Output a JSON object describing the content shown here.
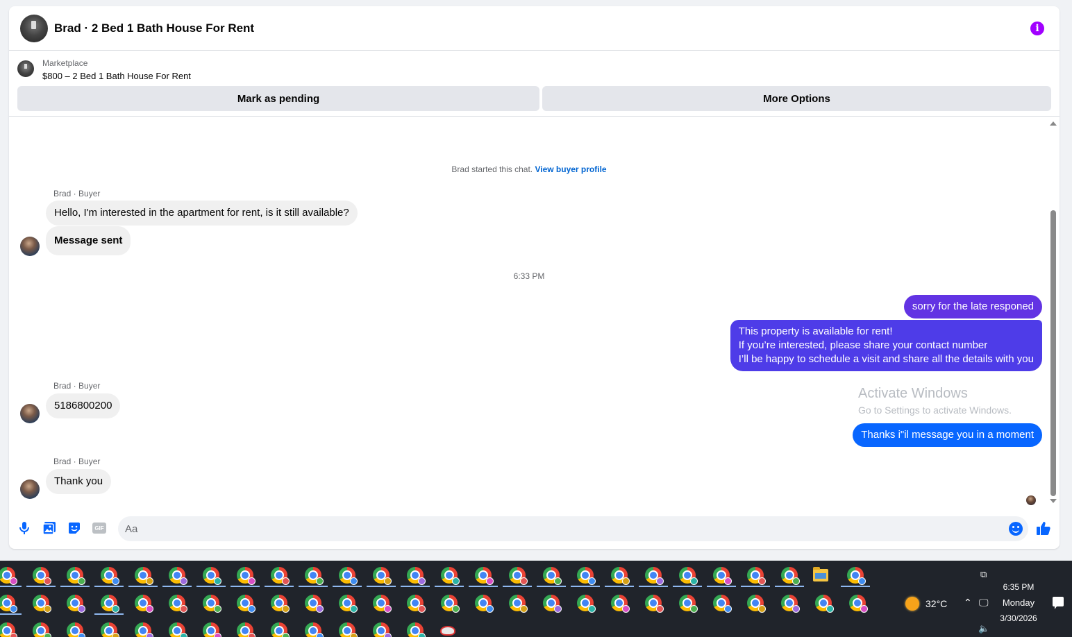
{
  "header": {
    "title": "Brad · 2 Bed 1 Bath House For Rent",
    "info_icon": "info-icon"
  },
  "listing": {
    "kind": "Marketplace",
    "name": "$800 – 2 Bed 1 Bath House For Rent",
    "mark_pending_label": "Mark as pending",
    "more_options_label": "More Options"
  },
  "chat": {
    "system_text": "Brad started this chat. ",
    "view_profile_link": "View buyer profile",
    "timestamp": "6:33 PM",
    "messages": [
      {
        "sender": "Brad · Buyer",
        "lines": [
          "Hello, I'm interested in the apartment for rent, is it still available?"
        ]
      },
      {
        "lines": [
          "Message sent"
        ]
      },
      {
        "lines": [
          "sorry for the late responed"
        ]
      },
      {
        "lines": [
          "This property is available for rent!",
          "If you’re interested, please share your contact number",
          "I’ll be happy to schedule a visit and share all the details with you"
        ]
      },
      {
        "sender": "Brad · Buyer",
        "lines": [
          "5186800200"
        ]
      },
      {
        "lines": [
          "Thanks i\"il message you in a moment"
        ]
      },
      {
        "sender": "Brad · Buyer",
        "lines": [
          "Thank you"
        ]
      }
    ]
  },
  "composer": {
    "placeholder": "Aa",
    "icons": [
      "microphone-icon",
      "photo-icon",
      "sticker-icon",
      "gif-icon",
      "emoji-icon",
      "thumbs-up-icon"
    ],
    "gif_label": "GIF"
  },
  "watermark": {
    "line1": "Activate Windows",
    "line2": "Go to Settings to activate Windows."
  },
  "taskbar": {
    "weather": "32°C",
    "time": "6:35 PM",
    "day": "Monday",
    "date": "3/30/2026"
  },
  "colors": {
    "accent": "#0866ff",
    "outgoing_purple": "#6233e3",
    "outgoing_indigo": "#4e3ce8",
    "info_purple": "#a100ff"
  }
}
